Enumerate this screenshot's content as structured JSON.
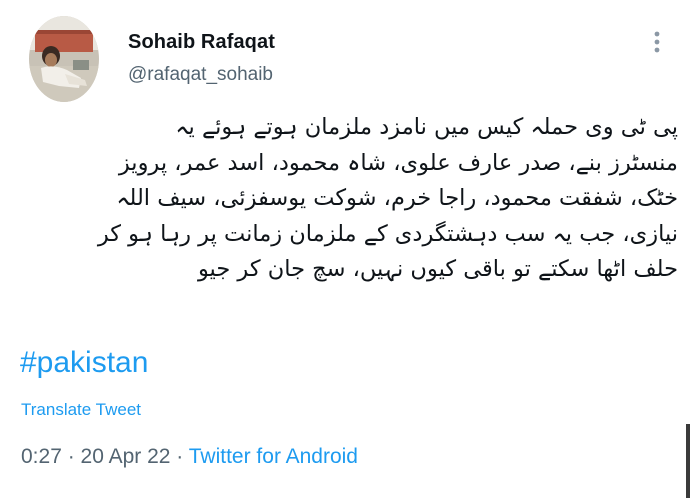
{
  "tweet": {
    "author": {
      "display_name": "Sohaib Rafaqat",
      "handle": "@rafaqat_sohaib"
    },
    "text_lines": [
      "پی ٹی وی حملہ کیس میں نامزد ملزمان ہوتے ہوئے یہ",
      "منسٹرز بنے، صدر عارف علوی، شاہ محمود، اسد عمر، پرویز",
      "خٹک، شفقت محمود، راجا خرم، شوکت یوسفزئی، سیف اللہ",
      "نیازی، جب یہ سب دہشتگردی کے ملزمان زمانت پر رہا ہو کر",
      "حلف اٹھا سکتے تو باقی کیوں نہیں، سچ جان کر جیو"
    ],
    "hashtag": "#pakistan",
    "translate_label": "Translate Tweet",
    "time": "0:27",
    "separator_1": " · ",
    "date": "20 Apr 22",
    "separator_2": " · ",
    "source": "Twitter for Android"
  },
  "icons": {
    "more": "more-vertical-icon",
    "avatar": "profile-photo"
  },
  "colors": {
    "link": "#1d9bf0",
    "text": "#0f1419",
    "secondary": "#536471"
  }
}
